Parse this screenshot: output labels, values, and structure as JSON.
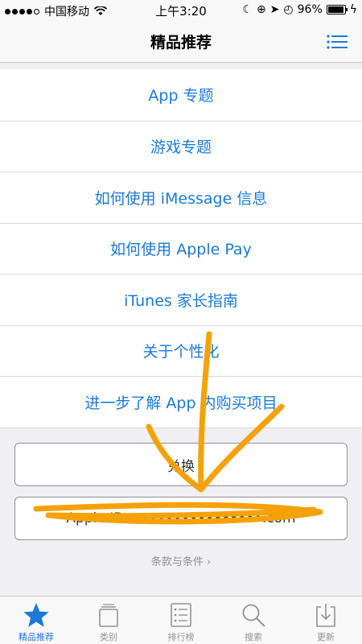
{
  "status_bar": {
    "carrier": "中国移动",
    "time": "上午3:20",
    "battery": "96%",
    "battery_level": 0.96
  },
  "nav": {
    "title": "精品推荐"
  },
  "links": [
    "App 专题",
    "游戏专题",
    "如何使用 iMessage 信息",
    "如何使用 Apple Pay",
    "iTunes 家长指南",
    "关于个性化",
    "进一步了解 App 内购买项目"
  ],
  "buttons": {
    "redeem": "兑换",
    "account": "Apple ID: ••••••••••••••••.com"
  },
  "terms": "条款与条件 ›",
  "tabs": [
    {
      "label": "精品推荐",
      "icon": "star-icon"
    },
    {
      "label": "类别",
      "icon": "categories-icon"
    },
    {
      "label": "排行榜",
      "icon": "list-icon"
    },
    {
      "label": "搜索",
      "icon": "search-icon"
    },
    {
      "label": "更新",
      "icon": "updates-icon"
    }
  ],
  "colors": {
    "accent": "#1a7ad6",
    "scribble": "#f5a10a"
  }
}
